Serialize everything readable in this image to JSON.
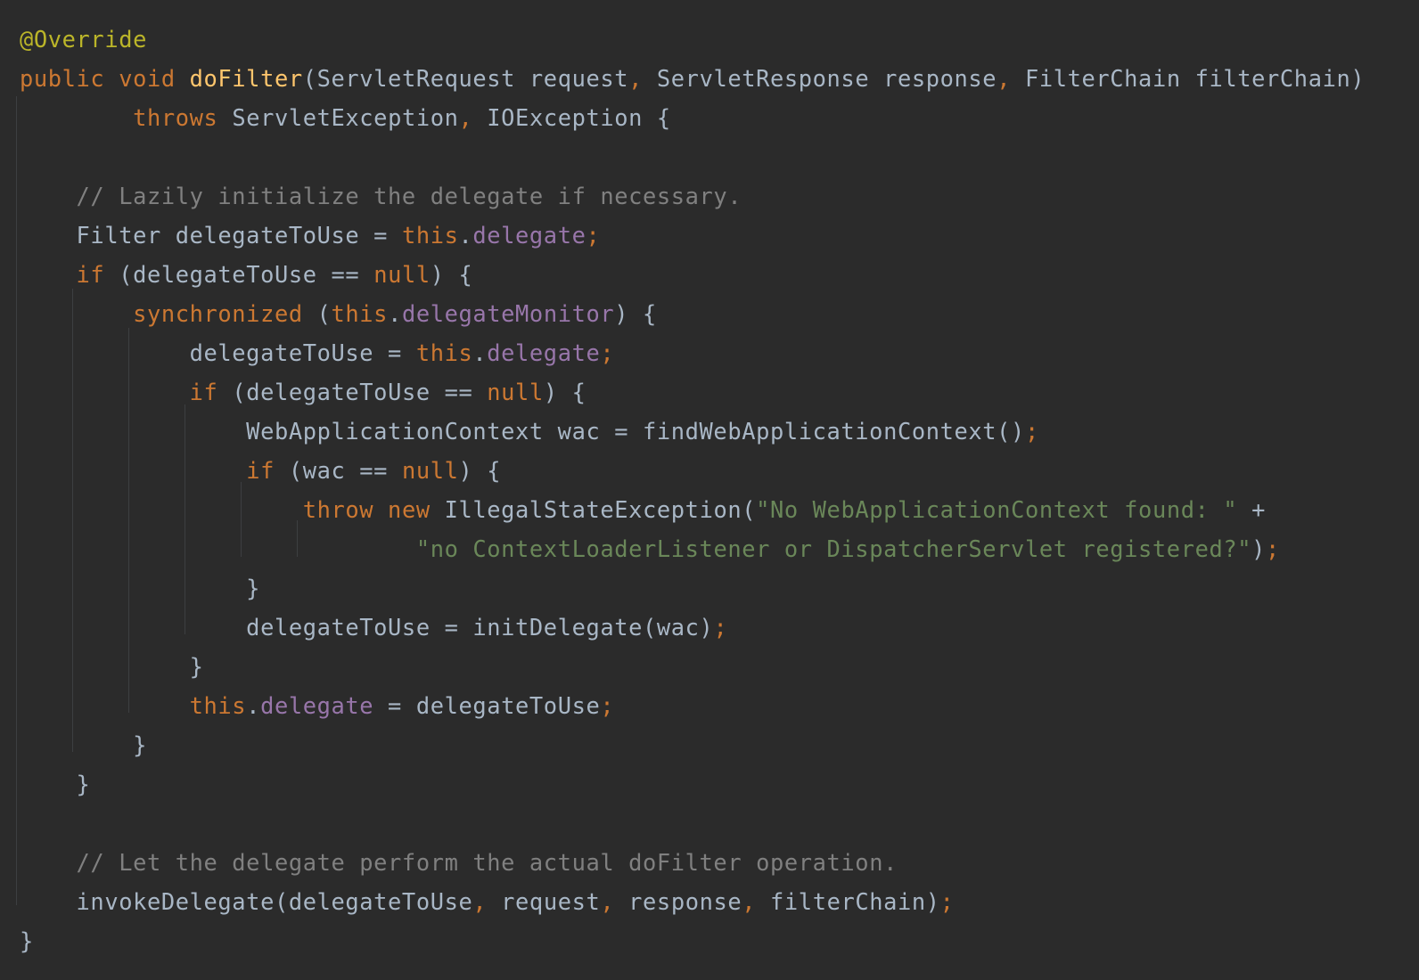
{
  "editor": {
    "language": "java",
    "theme_colors": {
      "background": "#2b2b2b",
      "plain": "#a9b7c6",
      "keyword": "#cc7832",
      "annotation": "#bbb529",
      "method": "#ffc66d",
      "field": "#9876aa",
      "string": "#6a8759",
      "comment": "#808080",
      "indent_guide": "#3d3f41"
    },
    "lines": [
      [
        {
          "t": "annotation",
          "v": "@Override"
        }
      ],
      [
        {
          "t": "keyword",
          "v": "public void "
        },
        {
          "t": "method",
          "v": "doFilter"
        },
        {
          "t": "plain",
          "v": "(ServletRequest request"
        },
        {
          "t": "punct",
          "v": ", "
        },
        {
          "t": "plain",
          "v": "ServletResponse response"
        },
        {
          "t": "punct",
          "v": ", "
        },
        {
          "t": "plain",
          "v": "FilterChain filterChain)"
        }
      ],
      [
        {
          "t": "plain",
          "v": "        "
        },
        {
          "t": "keyword",
          "v": "throws "
        },
        {
          "t": "plain",
          "v": "ServletException"
        },
        {
          "t": "punct",
          "v": ", "
        },
        {
          "t": "plain",
          "v": "IOException {"
        }
      ],
      [],
      [
        {
          "t": "plain",
          "v": "    "
        },
        {
          "t": "comment",
          "v": "// Lazily initialize the delegate if necessary."
        }
      ],
      [
        {
          "t": "plain",
          "v": "    Filter delegateToUse = "
        },
        {
          "t": "keyword",
          "v": "this"
        },
        {
          "t": "plain",
          "v": "."
        },
        {
          "t": "field",
          "v": "delegate"
        },
        {
          "t": "punct",
          "v": ";"
        }
      ],
      [
        {
          "t": "plain",
          "v": "    "
        },
        {
          "t": "keyword",
          "v": "if "
        },
        {
          "t": "plain",
          "v": "(delegateToUse == "
        },
        {
          "t": "keyword",
          "v": "null"
        },
        {
          "t": "plain",
          "v": ") {"
        }
      ],
      [
        {
          "t": "plain",
          "v": "        "
        },
        {
          "t": "keyword",
          "v": "synchronized "
        },
        {
          "t": "plain",
          "v": "("
        },
        {
          "t": "keyword",
          "v": "this"
        },
        {
          "t": "plain",
          "v": "."
        },
        {
          "t": "field",
          "v": "delegateMonitor"
        },
        {
          "t": "plain",
          "v": ") {"
        }
      ],
      [
        {
          "t": "plain",
          "v": "            delegateToUse = "
        },
        {
          "t": "keyword",
          "v": "this"
        },
        {
          "t": "plain",
          "v": "."
        },
        {
          "t": "field",
          "v": "delegate"
        },
        {
          "t": "punct",
          "v": ";"
        }
      ],
      [
        {
          "t": "plain",
          "v": "            "
        },
        {
          "t": "keyword",
          "v": "if "
        },
        {
          "t": "plain",
          "v": "(delegateToUse == "
        },
        {
          "t": "keyword",
          "v": "null"
        },
        {
          "t": "plain",
          "v": ") {"
        }
      ],
      [
        {
          "t": "plain",
          "v": "                WebApplicationContext wac = findWebApplicationContext()"
        },
        {
          "t": "punct",
          "v": ";"
        }
      ],
      [
        {
          "t": "plain",
          "v": "                "
        },
        {
          "t": "keyword",
          "v": "if "
        },
        {
          "t": "plain",
          "v": "(wac == "
        },
        {
          "t": "keyword",
          "v": "null"
        },
        {
          "t": "plain",
          "v": ") {"
        }
      ],
      [
        {
          "t": "plain",
          "v": "                    "
        },
        {
          "t": "keyword",
          "v": "throw new "
        },
        {
          "t": "plain",
          "v": "IllegalStateException("
        },
        {
          "t": "string",
          "v": "\"No WebApplicationContext found: \""
        },
        {
          "t": "plain",
          "v": " +"
        }
      ],
      [
        {
          "t": "plain",
          "v": "                            "
        },
        {
          "t": "string",
          "v": "\"no ContextLoaderListener or DispatcherServlet registered?\""
        },
        {
          "t": "plain",
          "v": ")"
        },
        {
          "t": "punct",
          "v": ";"
        }
      ],
      [
        {
          "t": "plain",
          "v": "                }"
        }
      ],
      [
        {
          "t": "plain",
          "v": "                delegateToUse = initDelegate(wac)"
        },
        {
          "t": "punct",
          "v": ";"
        }
      ],
      [
        {
          "t": "plain",
          "v": "            }"
        }
      ],
      [
        {
          "t": "plain",
          "v": "            "
        },
        {
          "t": "keyword",
          "v": "this"
        },
        {
          "t": "plain",
          "v": "."
        },
        {
          "t": "field",
          "v": "delegate"
        },
        {
          "t": "plain",
          "v": " = delegateToUse"
        },
        {
          "t": "punct",
          "v": ";"
        }
      ],
      [
        {
          "t": "plain",
          "v": "        }"
        }
      ],
      [
        {
          "t": "plain",
          "v": "    }"
        }
      ],
      [],
      [
        {
          "t": "plain",
          "v": "    "
        },
        {
          "t": "comment",
          "v": "// Let the delegate perform the actual doFilter operation."
        }
      ],
      [
        {
          "t": "plain",
          "v": "    invokeDelegate(delegateToUse"
        },
        {
          "t": "punct",
          "v": ", "
        },
        {
          "t": "plain",
          "v": "request"
        },
        {
          "t": "punct",
          "v": ", "
        },
        {
          "t": "plain",
          "v": "response"
        },
        {
          "t": "punct",
          "v": ", "
        },
        {
          "t": "plain",
          "v": "filterChain)"
        },
        {
          "t": "punct",
          "v": ";"
        }
      ],
      [
        {
          "t": "plain",
          "v": "}"
        }
      ]
    ]
  }
}
